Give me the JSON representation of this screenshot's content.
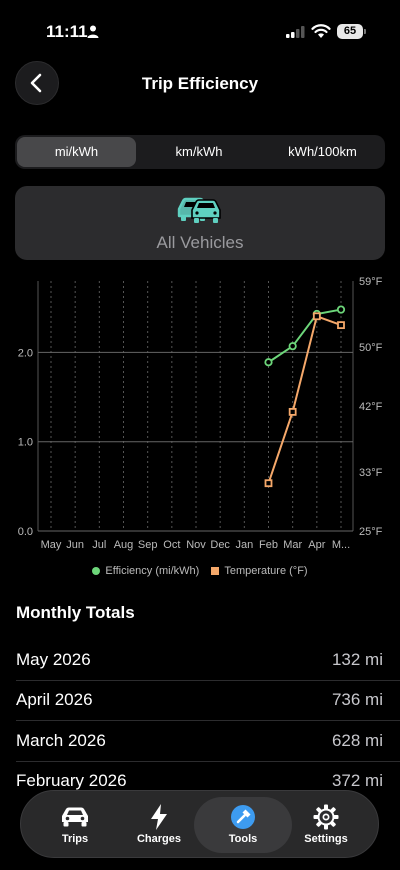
{
  "status_bar": {
    "time": "11:11",
    "battery": "65"
  },
  "header": {
    "title": "Trip Efficiency"
  },
  "units": {
    "options": [
      "mi/kWh",
      "km/kWh",
      "kWh/100km"
    ],
    "selected": "mi/kWh"
  },
  "vehicle": {
    "label": "All Vehicles"
  },
  "chart_data": {
    "type": "line",
    "categories": [
      "May",
      "Jun",
      "Jul",
      "Aug",
      "Sep",
      "Oct",
      "Nov",
      "Dec",
      "Jan",
      "Feb",
      "Mar",
      "Apr",
      "M..."
    ],
    "y_left_ticks": [
      "0.0",
      "1.0",
      "2.0"
    ],
    "y_right_ticks": [
      "25°F",
      "33°F",
      "42°F",
      "50°F",
      "59°F"
    ],
    "ylim_left": [
      0,
      2.8
    ],
    "ylim_right": [
      25,
      59
    ],
    "grid": true,
    "legend_position": "bottom",
    "series": [
      {
        "name": "Efficiency (mi/kWh)",
        "axis": "left",
        "color": "#6dd67a",
        "marker": "circle",
        "values": [
          null,
          null,
          null,
          null,
          null,
          null,
          null,
          null,
          null,
          1.89,
          2.07,
          2.43,
          2.48
        ]
      },
      {
        "name": "Temperature (°F)",
        "axis": "right",
        "color": "#f5a86a",
        "marker": "square",
        "values": [
          null,
          null,
          null,
          null,
          null,
          null,
          null,
          null,
          null,
          31.5,
          41.2,
          54.2,
          53.0
        ]
      }
    ]
  },
  "monthly_totals": {
    "title": "Monthly Totals",
    "rows": [
      {
        "month": "May 2026",
        "value": "132 mi"
      },
      {
        "month": "April 2026",
        "value": "736 mi"
      },
      {
        "month": "March 2026",
        "value": "628 mi"
      },
      {
        "month": "February 2026",
        "value": "372 mi"
      }
    ]
  },
  "tabbar": {
    "items": [
      {
        "label": "Trips",
        "icon": "car-icon"
      },
      {
        "label": "Charges",
        "icon": "lightning-bolt-icon"
      },
      {
        "label": "Tools",
        "icon": "hammer-icon",
        "active": true
      },
      {
        "label": "Settings",
        "icon": "gear-icon"
      }
    ]
  }
}
